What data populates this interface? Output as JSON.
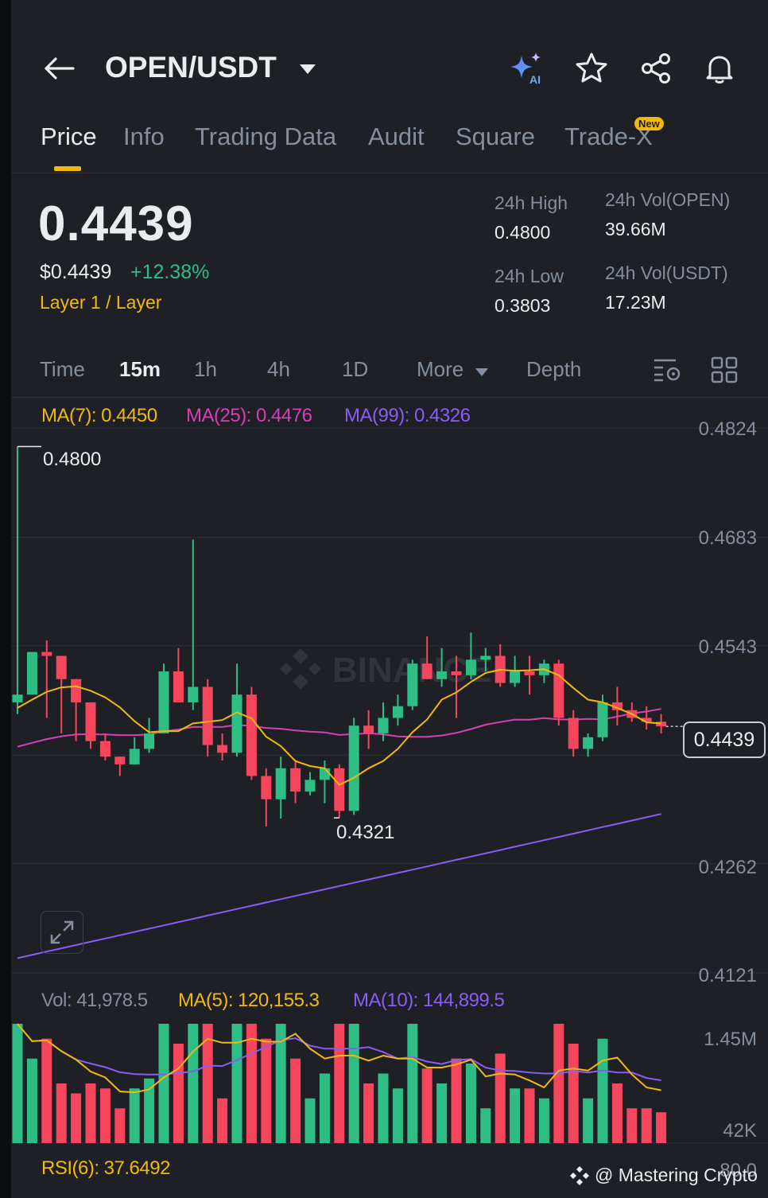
{
  "header": {
    "pair": "OPEN/USDT",
    "ai_badge": "AI"
  },
  "tabs": [
    {
      "label": "Price",
      "active": true
    },
    {
      "label": "Info"
    },
    {
      "label": "Trading Data"
    },
    {
      "label": "Audit"
    },
    {
      "label": "Square"
    },
    {
      "label": "Trade-X",
      "badge": "New"
    }
  ],
  "price": {
    "last": "0.4439",
    "usd": "$0.4439",
    "change": "+12.38%",
    "tags": "Layer 1 / Layer"
  },
  "stats": {
    "high_label": "24h High",
    "high": "0.4800",
    "low_label": "24h Low",
    "low": "0.3803",
    "vol_open_label": "24h Vol(OPEN)",
    "vol_open": "39.66M",
    "vol_usdt_label": "24h Vol(USDT)",
    "vol_usdt": "17.23M"
  },
  "timeframes": [
    "Time",
    "15m",
    "1h",
    "4h",
    "1D",
    "More",
    "Depth"
  ],
  "active_timeframe": "15m",
  "indicators": {
    "ma7": "MA(7): 0.4450",
    "ma25": "MA(25): 0.4476",
    "ma99": "MA(99): 0.4326",
    "vol": "Vol: 41,978.5",
    "vol_ma5": "MA(5): 120,155.3",
    "vol_ma10": "MA(10): 144,899.5",
    "rsi": "RSI(6): 37.6492"
  },
  "colors": {
    "up": "#2ebd85",
    "down": "#f6465d",
    "ma7": "#f0b90b",
    "ma25": "#d63fb8",
    "ma99": "#8a5cf5",
    "accent": "#f0b90b"
  },
  "watermark": "@ Mastering Crypto",
  "chart_data": {
    "type": "candlestick",
    "y_ticks": [
      "0.4824",
      "0.4683",
      "0.4543",
      "0.4262",
      "0.4121"
    ],
    "ylim": [
      0.4121,
      0.4824
    ],
    "current_price_label": "0.4439",
    "high_marker": "0.4800",
    "low_marker": "0.4321",
    "candles": [
      {
        "o": 0.447,
        "h": 0.48,
        "l": 0.4455,
        "c": 0.448
      },
      {
        "o": 0.448,
        "h": 0.45,
        "l": 0.453,
        "c": 0.4535
      },
      {
        "o": 0.4535,
        "h": 0.455,
        "l": 0.445,
        "c": 0.453
      },
      {
        "o": 0.453,
        "h": 0.446,
        "l": 0.443,
        "c": 0.45
      },
      {
        "o": 0.45,
        "h": 0.444,
        "l": 0.442,
        "c": 0.447
      },
      {
        "o": 0.447,
        "h": 0.442,
        "l": 0.441,
        "c": 0.442
      },
      {
        "o": 0.442,
        "h": 0.443,
        "l": 0.4395,
        "c": 0.44
      },
      {
        "o": 0.44,
        "h": 0.44,
        "l": 0.4375,
        "c": 0.439
      },
      {
        "o": 0.439,
        "h": 0.4425,
        "l": 0.439,
        "c": 0.441
      },
      {
        "o": 0.441,
        "h": 0.445,
        "l": 0.4405,
        "c": 0.443
      },
      {
        "o": 0.443,
        "h": 0.452,
        "l": 0.443,
        "c": 0.451
      },
      {
        "o": 0.451,
        "h": 0.454,
        "l": 0.448,
        "c": 0.447
      },
      {
        "o": 0.447,
        "h": 0.468,
        "l": 0.446,
        "c": 0.449
      },
      {
        "o": 0.449,
        "h": 0.45,
        "l": 0.44,
        "c": 0.4415
      },
      {
        "o": 0.4415,
        "h": 0.443,
        "l": 0.4395,
        "c": 0.4405
      },
      {
        "o": 0.4405,
        "h": 0.452,
        "l": 0.44,
        "c": 0.448
      },
      {
        "o": 0.448,
        "h": 0.449,
        "l": 0.437,
        "c": 0.4375
      },
      {
        "o": 0.4375,
        "h": 0.4385,
        "l": 0.431,
        "c": 0.4345
      },
      {
        "o": 0.4345,
        "h": 0.44,
        "l": 0.432,
        "c": 0.4385
      },
      {
        "o": 0.4385,
        "h": 0.4395,
        "l": 0.434,
        "c": 0.4355
      },
      {
        "o": 0.4355,
        "h": 0.438,
        "l": 0.435,
        "c": 0.437
      },
      {
        "o": 0.437,
        "h": 0.4395,
        "l": 0.434,
        "c": 0.4385
      },
      {
        "o": 0.4385,
        "h": 0.439,
        "l": 0.4321,
        "c": 0.433
      },
      {
        "o": 0.433,
        "h": 0.445,
        "l": 0.4325,
        "c": 0.444
      },
      {
        "o": 0.444,
        "h": 0.446,
        "l": 0.441,
        "c": 0.443
      },
      {
        "o": 0.443,
        "h": 0.447,
        "l": 0.442,
        "c": 0.445
      },
      {
        "o": 0.445,
        "h": 0.448,
        "l": 0.444,
        "c": 0.4465
      },
      {
        "o": 0.4465,
        "h": 0.4525,
        "l": 0.446,
        "c": 0.452
      },
      {
        "o": 0.452,
        "h": 0.4555,
        "l": 0.45,
        "c": 0.45
      },
      {
        "o": 0.45,
        "h": 0.454,
        "l": 0.449,
        "c": 0.451
      },
      {
        "o": 0.451,
        "h": 0.453,
        "l": 0.445,
        "c": 0.4505
      },
      {
        "o": 0.4505,
        "h": 0.456,
        "l": 0.45,
        "c": 0.4525
      },
      {
        "o": 0.4525,
        "h": 0.454,
        "l": 0.451,
        "c": 0.453
      },
      {
        "o": 0.453,
        "h": 0.4545,
        "l": 0.449,
        "c": 0.4495
      },
      {
        "o": 0.4495,
        "h": 0.453,
        "l": 0.449,
        "c": 0.451
      },
      {
        "o": 0.451,
        "h": 0.453,
        "l": 0.448,
        "c": 0.4505
      },
      {
        "o": 0.4505,
        "h": 0.4525,
        "l": 0.4495,
        "c": 0.452
      },
      {
        "o": 0.452,
        "h": 0.4525,
        "l": 0.444,
        "c": 0.445
      },
      {
        "o": 0.445,
        "h": 0.446,
        "l": 0.44,
        "c": 0.441
      },
      {
        "o": 0.441,
        "h": 0.443,
        "l": 0.44,
        "c": 0.4425
      },
      {
        "o": 0.4425,
        "h": 0.448,
        "l": 0.442,
        "c": 0.447
      },
      {
        "o": 0.447,
        "h": 0.449,
        "l": 0.444,
        "c": 0.446
      },
      {
        "o": 0.446,
        "h": 0.447,
        "l": 0.4445,
        "c": 0.445
      },
      {
        "o": 0.445,
        "h": 0.4465,
        "l": 0.4435,
        "c": 0.4445
      },
      {
        "o": 0.4445,
        "h": 0.4455,
        "l": 0.443,
        "c": 0.4439
      }
    ],
    "volume_ticks": [
      "1.45M",
      "42K"
    ],
    "rsi_tick": "80.0"
  }
}
